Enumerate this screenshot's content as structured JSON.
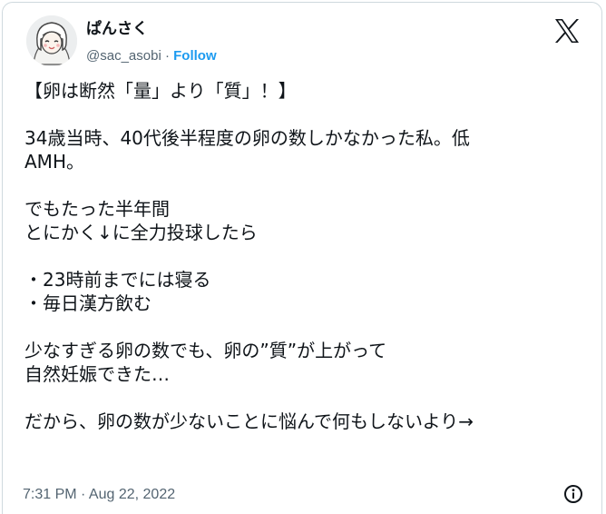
{
  "header": {
    "display_name": "ぱんさく",
    "handle": "@sac_asobi",
    "separator": " · ",
    "follow_label": "Follow",
    "logo_icon": "x-logo-icon"
  },
  "body": {
    "lines": [
      "【卵は断然「量」より「質」！】",
      "",
      "34歳当時、40代後半程度の卵の数しかなかった私。低",
      "AMH。",
      "",
      "でもたった半年間",
      "とにかく↓に全力投球したら",
      "",
      "・23時前までには寝る",
      "・毎日漢方飲む",
      "",
      "少なすぎる卵の数でも、卵の”質”が上がって",
      "自然妊娠できた…",
      "",
      "だから、卵の数が少ないことに悩んで何もしないより→"
    ]
  },
  "footer": {
    "timestamp": "7:31 PM · Aug 22, 2022",
    "info_icon": "info-icon"
  },
  "colors": {
    "text": "#0f1419",
    "secondary": "#536471",
    "accent": "#1d9bf0",
    "border": "#cfd9de"
  }
}
